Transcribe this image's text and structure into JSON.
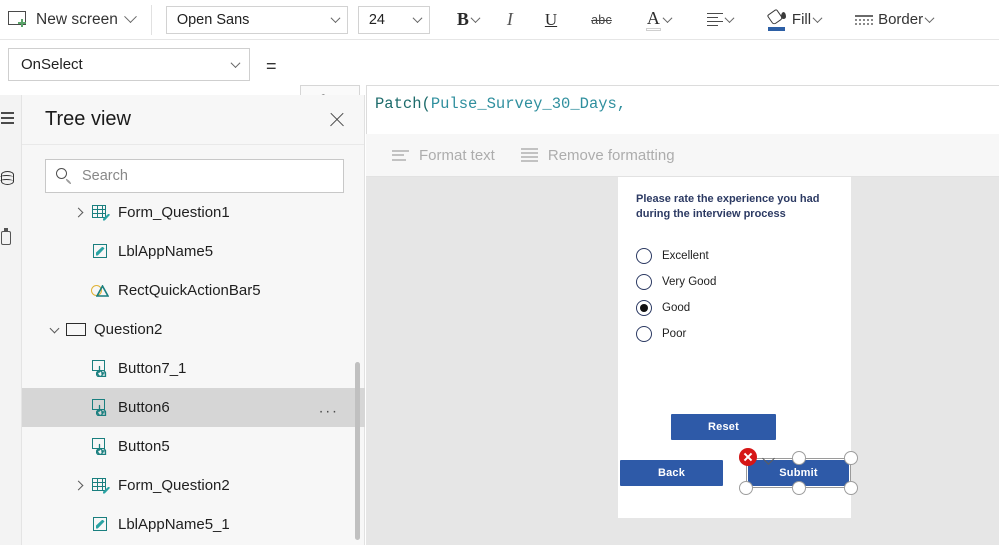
{
  "toolbar": {
    "new_screen_label": "New screen",
    "font_family_value": "Open Sans",
    "font_size_value": "24",
    "bold_label": "B",
    "italic_label": "I",
    "underline_label": "U",
    "strikethrough_label": "abc",
    "font_color_label": "A",
    "fill_label": "Fill",
    "border_label": "Border"
  },
  "formula": {
    "property_value": "OnSelect",
    "equals": "=",
    "fx_label": "fx",
    "text_fn": "Patch(",
    "text_table": "Pulse_Survey_30_Days,"
  },
  "format_bar": {
    "format_text_label": "Format text",
    "remove_formatting_label": "Remove formatting"
  },
  "tree": {
    "title": "Tree view",
    "search_placeholder": "Search",
    "items": [
      {
        "label": "Form_Question1",
        "icon": "form-icon",
        "indent": 1,
        "expander": "collapsed",
        "selected": false
      },
      {
        "label": "LblAppName5",
        "icon": "label-icon",
        "indent": 1,
        "expander": "none",
        "selected": false
      },
      {
        "label": "RectQuickActionBar5",
        "icon": "shape-icon",
        "indent": 1,
        "expander": "none",
        "selected": false
      },
      {
        "label": "Question2",
        "icon": "screen-icon",
        "indent": 0,
        "expander": "expanded",
        "selected": false
      },
      {
        "label": "Button7_1",
        "icon": "button-icon",
        "indent": 1,
        "expander": "none",
        "selected": false
      },
      {
        "label": "Button6",
        "icon": "button-icon",
        "indent": 1,
        "expander": "none",
        "selected": true,
        "overflow": "..."
      },
      {
        "label": "Button5",
        "icon": "button-icon",
        "indent": 1,
        "expander": "none",
        "selected": false
      },
      {
        "label": "Form_Question2",
        "icon": "form-icon",
        "indent": 1,
        "expander": "collapsed",
        "selected": false
      },
      {
        "label": "LblAppName5_1",
        "icon": "label-icon",
        "indent": 1,
        "expander": "none",
        "selected": false
      }
    ]
  },
  "canvas": {
    "question_text": "Please rate the experience you had during the interview process",
    "options": [
      {
        "label": "Excellent",
        "selected": false
      },
      {
        "label": "Very Good",
        "selected": false
      },
      {
        "label": "Good",
        "selected": true
      },
      {
        "label": "Poor",
        "selected": false
      }
    ],
    "reset_button": "Reset",
    "back_button": "Back",
    "submit_button": "Submit",
    "accent_color": "#2e5aa8",
    "error_color": "#d61616",
    "question_color": "#2c3a63"
  }
}
